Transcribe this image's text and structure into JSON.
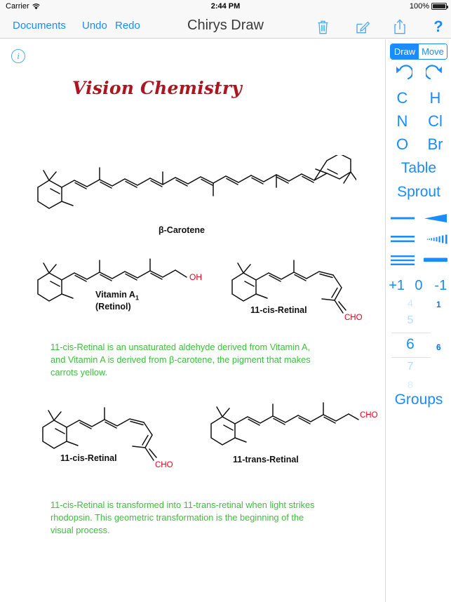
{
  "status_bar": {
    "carrier": "Carrier",
    "wifi_icon": "wifi-icon",
    "time": "2:44 PM",
    "battery_percent": "100%",
    "battery_icon": "battery-full-icon"
  },
  "navbar": {
    "documents_label": "Documents",
    "undo_label": "Undo",
    "redo_label": "Redo",
    "app_title": "Chirys Draw",
    "trash_icon": "trash-icon",
    "compose_icon": "compose-icon",
    "share_icon": "share-icon",
    "help_label": "?"
  },
  "canvas": {
    "info_icon": "info-icon",
    "info_glyph": "i",
    "document_title": "Vision Chemistry",
    "structures": [
      {
        "name": "beta-carotene",
        "label": "β-Carotene"
      },
      {
        "name": "vitamin-a1",
        "label_line1": "Vitamin A",
        "label_sub": "1",
        "label_line2": "(Retinol)",
        "terminal_group": "OH"
      },
      {
        "name": "11-cis-retinal-top",
        "label": "11-cis-Retinal",
        "terminal_group": "CHO"
      },
      {
        "name": "11-cis-retinal-bottom",
        "label": "11-cis-Retinal",
        "terminal_group": "CHO"
      },
      {
        "name": "11-trans-retinal",
        "label": "11-trans-Retinal",
        "terminal_group": "CHO"
      }
    ],
    "notes": [
      "11-cis-Retinal is an unsaturated aldehyde derived from Vitamin A,\nand Vitamin A is derived from β-carotene, the pigment that makes\ncarrots yellow.",
      "11-cis-Retinal is transformed into 11-trans-retinal when light strikes\nrhodopsin.  This geometric transformation is the beginning of the\nvisual process."
    ]
  },
  "sidebar": {
    "mode_draw": "Draw",
    "mode_move": "Move",
    "selected_mode": "Draw",
    "undo_icon": "undo-arrow-icon",
    "redo_icon": "redo-arrow-icon",
    "elements": [
      "C",
      "H",
      "N",
      "Cl",
      "O",
      "Br"
    ],
    "table_label": "Table",
    "sprout_label": "Sprout",
    "bond_tools": [
      "single-bond-icon",
      "wedge-bond-icon",
      "double-bond-icon",
      "hash-wedge-bond-icon",
      "triple-bond-icon",
      "bold-bond-icon"
    ],
    "charges": [
      "+1",
      "0",
      "-1"
    ],
    "ring_sizes": [
      "4",
      "5",
      "6",
      "7",
      "8"
    ],
    "selected_ring_size": "6",
    "bond_order_value": "1",
    "ring_value": "6",
    "groups_label": "Groups"
  },
  "colors": {
    "accent_blue": "#1a8cff",
    "title_red": "#ad1621",
    "note_green": "#3cbf3c",
    "heteroatom_red": "#e8001c",
    "bond_black": "#111111"
  }
}
